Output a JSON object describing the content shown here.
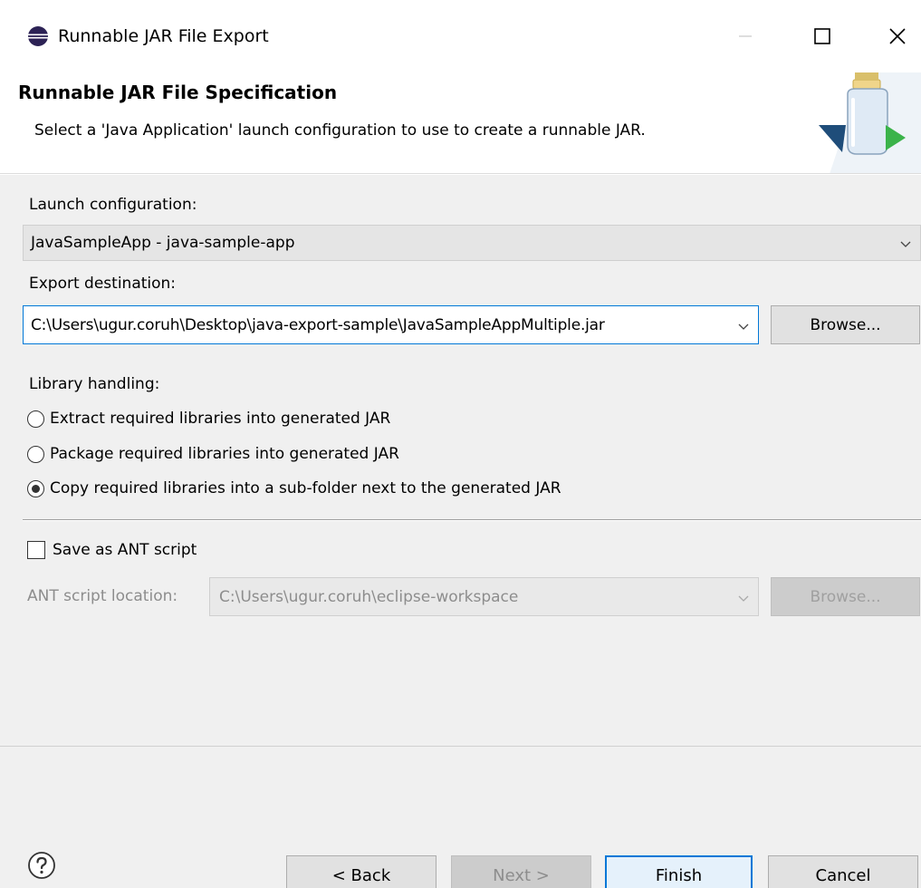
{
  "window": {
    "title": "Runnable JAR File Export",
    "icon": "eclipse-icon",
    "controls": [
      "minimize-icon",
      "maximize-icon",
      "close-icon"
    ]
  },
  "header": {
    "title": "Runnable JAR File Specification",
    "description": "Select a 'Java Application' launch configuration to use to create a runnable JAR.",
    "banner_icon": "jar-export-icon"
  },
  "launch": {
    "label": "Launch configuration:",
    "value": "JavaSampleApp - java-sample-app"
  },
  "export": {
    "label": "Export destination:",
    "value": "C:\\Users\\ugur.coruh\\Desktop\\java-export-sample\\JavaSampleAppMultiple.jar",
    "browse_label": "Browse..."
  },
  "library": {
    "label": "Library handling:",
    "options": [
      {
        "label": "Extract required libraries into generated JAR",
        "checked": false
      },
      {
        "label": "Package required libraries into generated JAR",
        "checked": false
      },
      {
        "label": "Copy required libraries into a sub-folder next to the generated JAR",
        "checked": true
      }
    ]
  },
  "ant": {
    "save_label": "Save as ANT script",
    "save_checked": false,
    "location_label": "ANT script location:",
    "location_value": "C:\\Users\\ugur.coruh\\eclipse-workspace",
    "browse_label": "Browse..."
  },
  "footer": {
    "help_icon": "help-icon",
    "back_label": "< Back",
    "next_label": "Next >",
    "finish_label": "Finish",
    "cancel_label": "Cancel"
  },
  "colors": {
    "accent": "#0078d7",
    "panel_bg": "#f0f0f0",
    "disabled_text": "#8d8d8d"
  }
}
